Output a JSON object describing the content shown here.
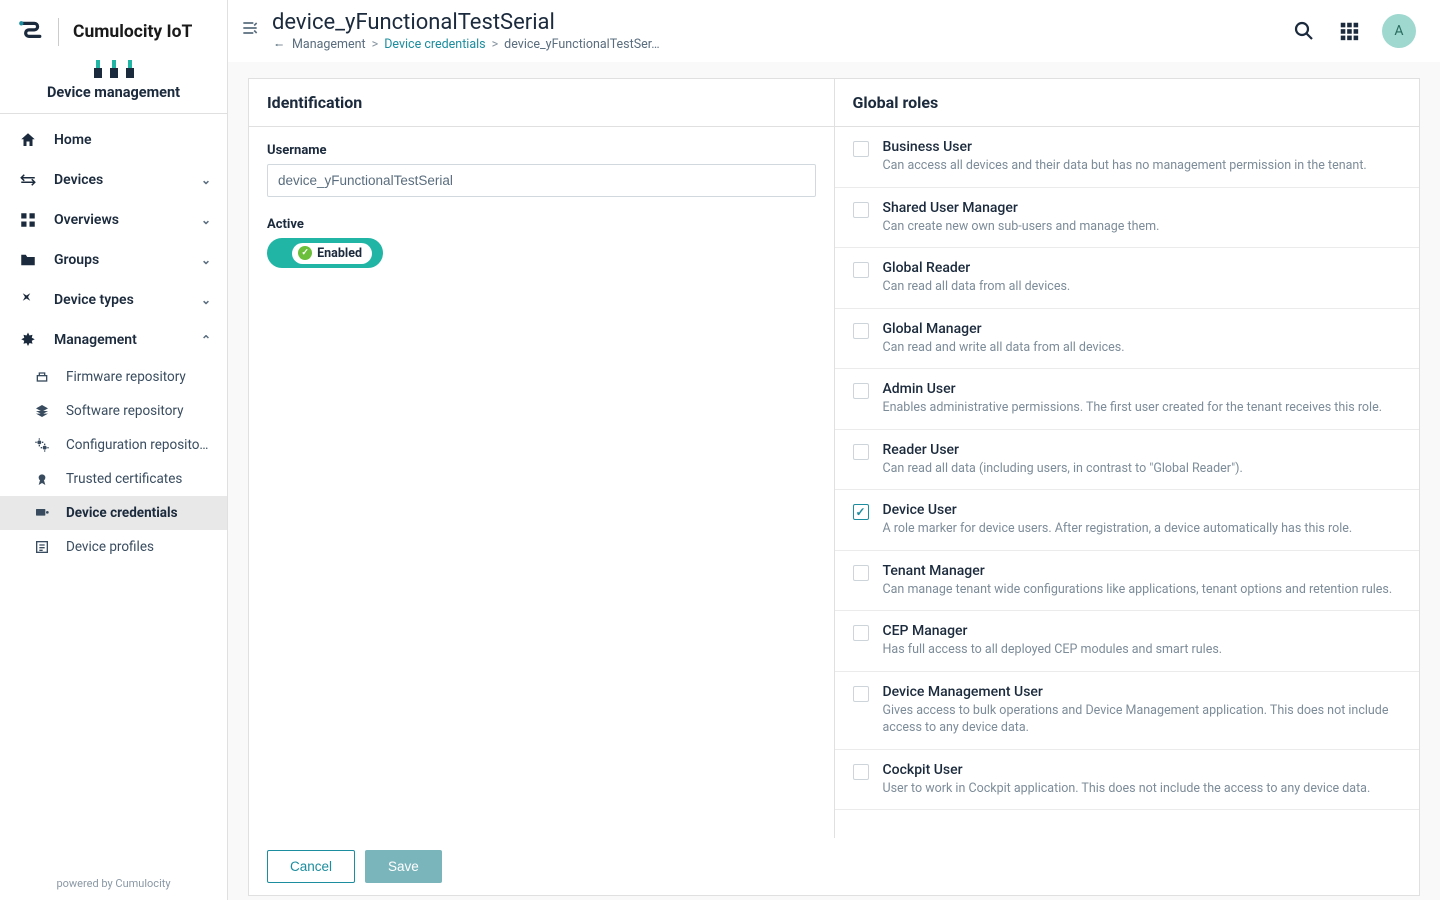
{
  "brand": {
    "name": "Cumulocity IoT",
    "sub": "Device management"
  },
  "sidebar": {
    "nav": [
      {
        "label": "Home",
        "expandable": false
      },
      {
        "label": "Devices",
        "expandable": true
      },
      {
        "label": "Overviews",
        "expandable": true
      },
      {
        "label": "Groups",
        "expandable": true
      },
      {
        "label": "Device types",
        "expandable": true
      },
      {
        "label": "Management",
        "expandable": true,
        "open": true
      }
    ],
    "management_children": [
      {
        "label": "Firmware repository"
      },
      {
        "label": "Software repository"
      },
      {
        "label": "Configuration reposito…"
      },
      {
        "label": "Trusted certificates"
      },
      {
        "label": "Device credentials",
        "active": true
      },
      {
        "label": "Device profiles"
      }
    ],
    "footer": "powered by Cumulocity"
  },
  "header": {
    "title": "device_yFunctionalTestSerial",
    "breadcrumb": {
      "root": "Management",
      "link": "Device credentials",
      "current": "device_yFunctionalTestSer…"
    },
    "avatar_letter": "A"
  },
  "identification": {
    "heading": "Identification",
    "username_label": "Username",
    "username_value": "device_yFunctionalTestSerial",
    "active_label": "Active",
    "enabled_text": "Enabled"
  },
  "roles": {
    "heading": "Global roles",
    "items": [
      {
        "name": "Business User",
        "desc": "Can access all devices and their data but has no management permission in the tenant.",
        "checked": false
      },
      {
        "name": "Shared User Manager",
        "desc": "Can create new own sub-users and manage them.",
        "checked": false
      },
      {
        "name": "Global Reader",
        "desc": "Can read all data from all devices.",
        "checked": false
      },
      {
        "name": "Global Manager",
        "desc": "Can read and write all data from all devices.",
        "checked": false
      },
      {
        "name": "Admin User",
        "desc": "Enables administrative permissions. The first user created for the tenant receives this role.",
        "checked": false
      },
      {
        "name": "Reader User",
        "desc": "Can read all data (including users, in contrast to \"Global Reader\").",
        "checked": false
      },
      {
        "name": "Device User",
        "desc": "A role marker for device users. After registration, a device automatically has this role.",
        "checked": true
      },
      {
        "name": "Tenant Manager",
        "desc": "Can manage tenant wide configurations like applications, tenant options and retention rules.",
        "checked": false
      },
      {
        "name": "CEP Manager",
        "desc": "Has full access to all deployed CEP modules and smart rules.",
        "checked": false
      },
      {
        "name": "Device Management User",
        "desc": "Gives access to bulk operations and Device Management application. This does not include access to any device data.",
        "checked": false
      },
      {
        "name": "Cockpit User",
        "desc": "User to work in Cockpit application. This does not include the access to any device data.",
        "checked": false
      }
    ]
  },
  "footer": {
    "cancel": "Cancel",
    "save": "Save"
  }
}
